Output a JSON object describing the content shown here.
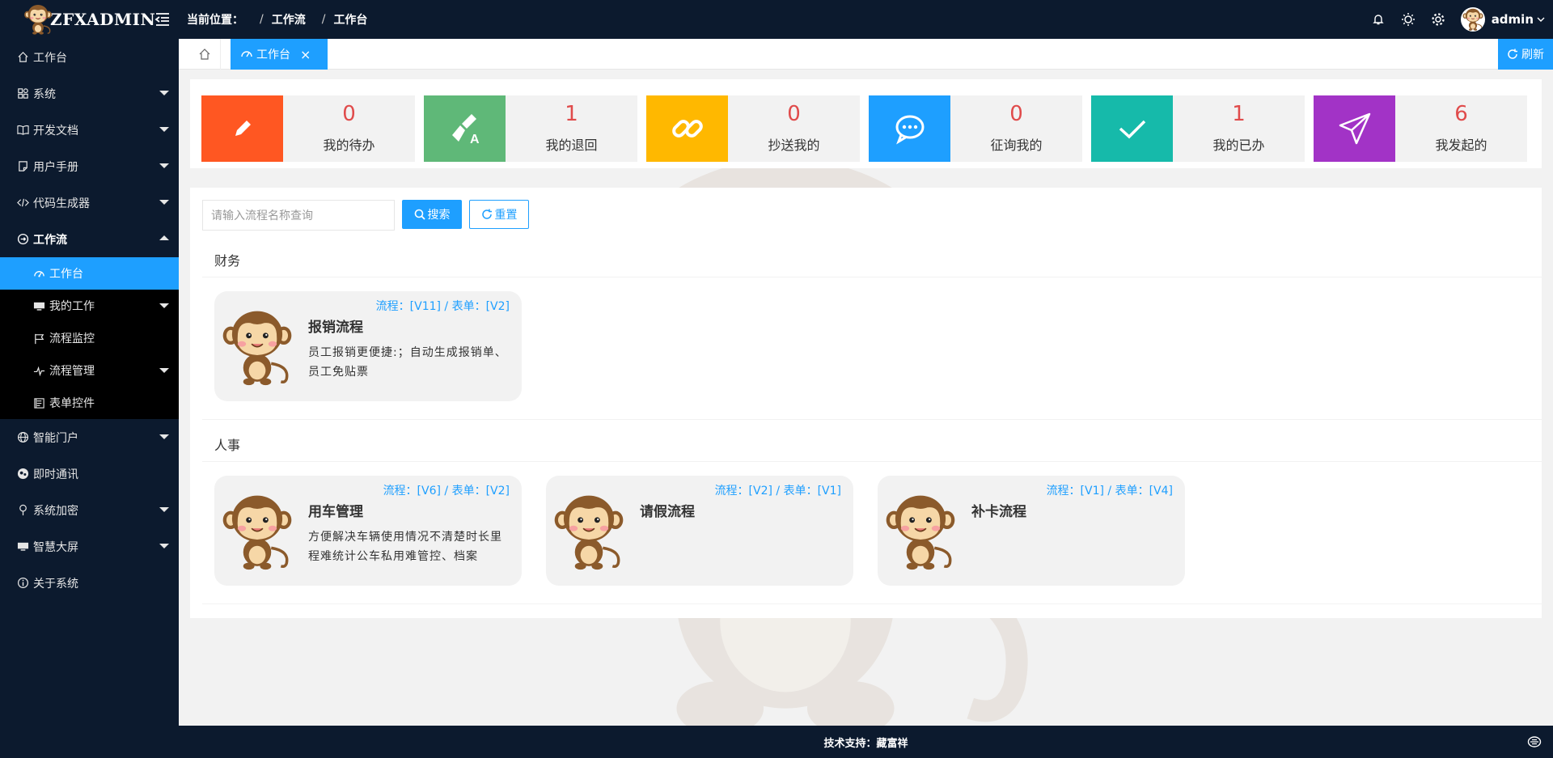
{
  "app": {
    "logo_text": "ZFXADMIN"
  },
  "header": {
    "location_label": "当前位置：",
    "crumbs": [
      "工作流",
      "工作台"
    ],
    "username": "admin"
  },
  "sidebar": {
    "items": [
      {
        "label": "工作台"
      },
      {
        "label": "系统"
      },
      {
        "label": "开发文档"
      },
      {
        "label": "用户手册"
      },
      {
        "label": "代码生成器"
      },
      {
        "label": "工作流"
      },
      {
        "label": "智能门户"
      },
      {
        "label": "即时通讯"
      },
      {
        "label": "系统加密"
      },
      {
        "label": "智慧大屏"
      },
      {
        "label": "关于系统"
      }
    ],
    "sub": [
      {
        "label": "工作台"
      },
      {
        "label": "我的工作"
      },
      {
        "label": "流程监控"
      },
      {
        "label": "流程管理"
      },
      {
        "label": "表单控件"
      }
    ]
  },
  "tabs": {
    "active": "工作台",
    "refresh": "刷新"
  },
  "stats": [
    {
      "value": "0",
      "label": "我的待办",
      "color": "#ff5722"
    },
    {
      "value": "1",
      "label": "我的退回",
      "color": "#5fb878"
    },
    {
      "value": "0",
      "label": "抄送我的",
      "color": "#ffb800"
    },
    {
      "value": "0",
      "label": "征询我的",
      "color": "#1e9fff"
    },
    {
      "value": "1",
      "label": "我的已办",
      "color": "#16baaa"
    },
    {
      "value": "6",
      "label": "我发起的",
      "color": "#a233c6"
    }
  ],
  "search": {
    "placeholder": "请输入流程名称查询",
    "search_label": "搜索",
    "reset_label": "重置"
  },
  "groups": [
    {
      "title": "财务",
      "flows": [
        {
          "version": "流程：[V11] / 表单：[V2]",
          "name": "报销流程",
          "desc": "员工报销更便捷:；自动生成报销单、员工免贴票"
        }
      ]
    },
    {
      "title": "人事",
      "flows": [
        {
          "version": "流程：[V6] / 表单：[V2]",
          "name": "用车管理",
          "desc": "方便解决车辆使用情况不清楚时长里程难统计公车私用难管控、档案"
        },
        {
          "version": "流程：[V2] / 表单：[V1]",
          "name": "请假流程",
          "desc": ""
        },
        {
          "version": "流程：[V1] / 表单：[V4]",
          "name": "补卡流程",
          "desc": ""
        }
      ]
    }
  ],
  "footer": {
    "text": "技术支持：藏富祥"
  },
  "colors": {
    "sidebar_bg": "#0c1a2e",
    "accent": "#1e9fff",
    "stat_number": "#e04b4b"
  }
}
